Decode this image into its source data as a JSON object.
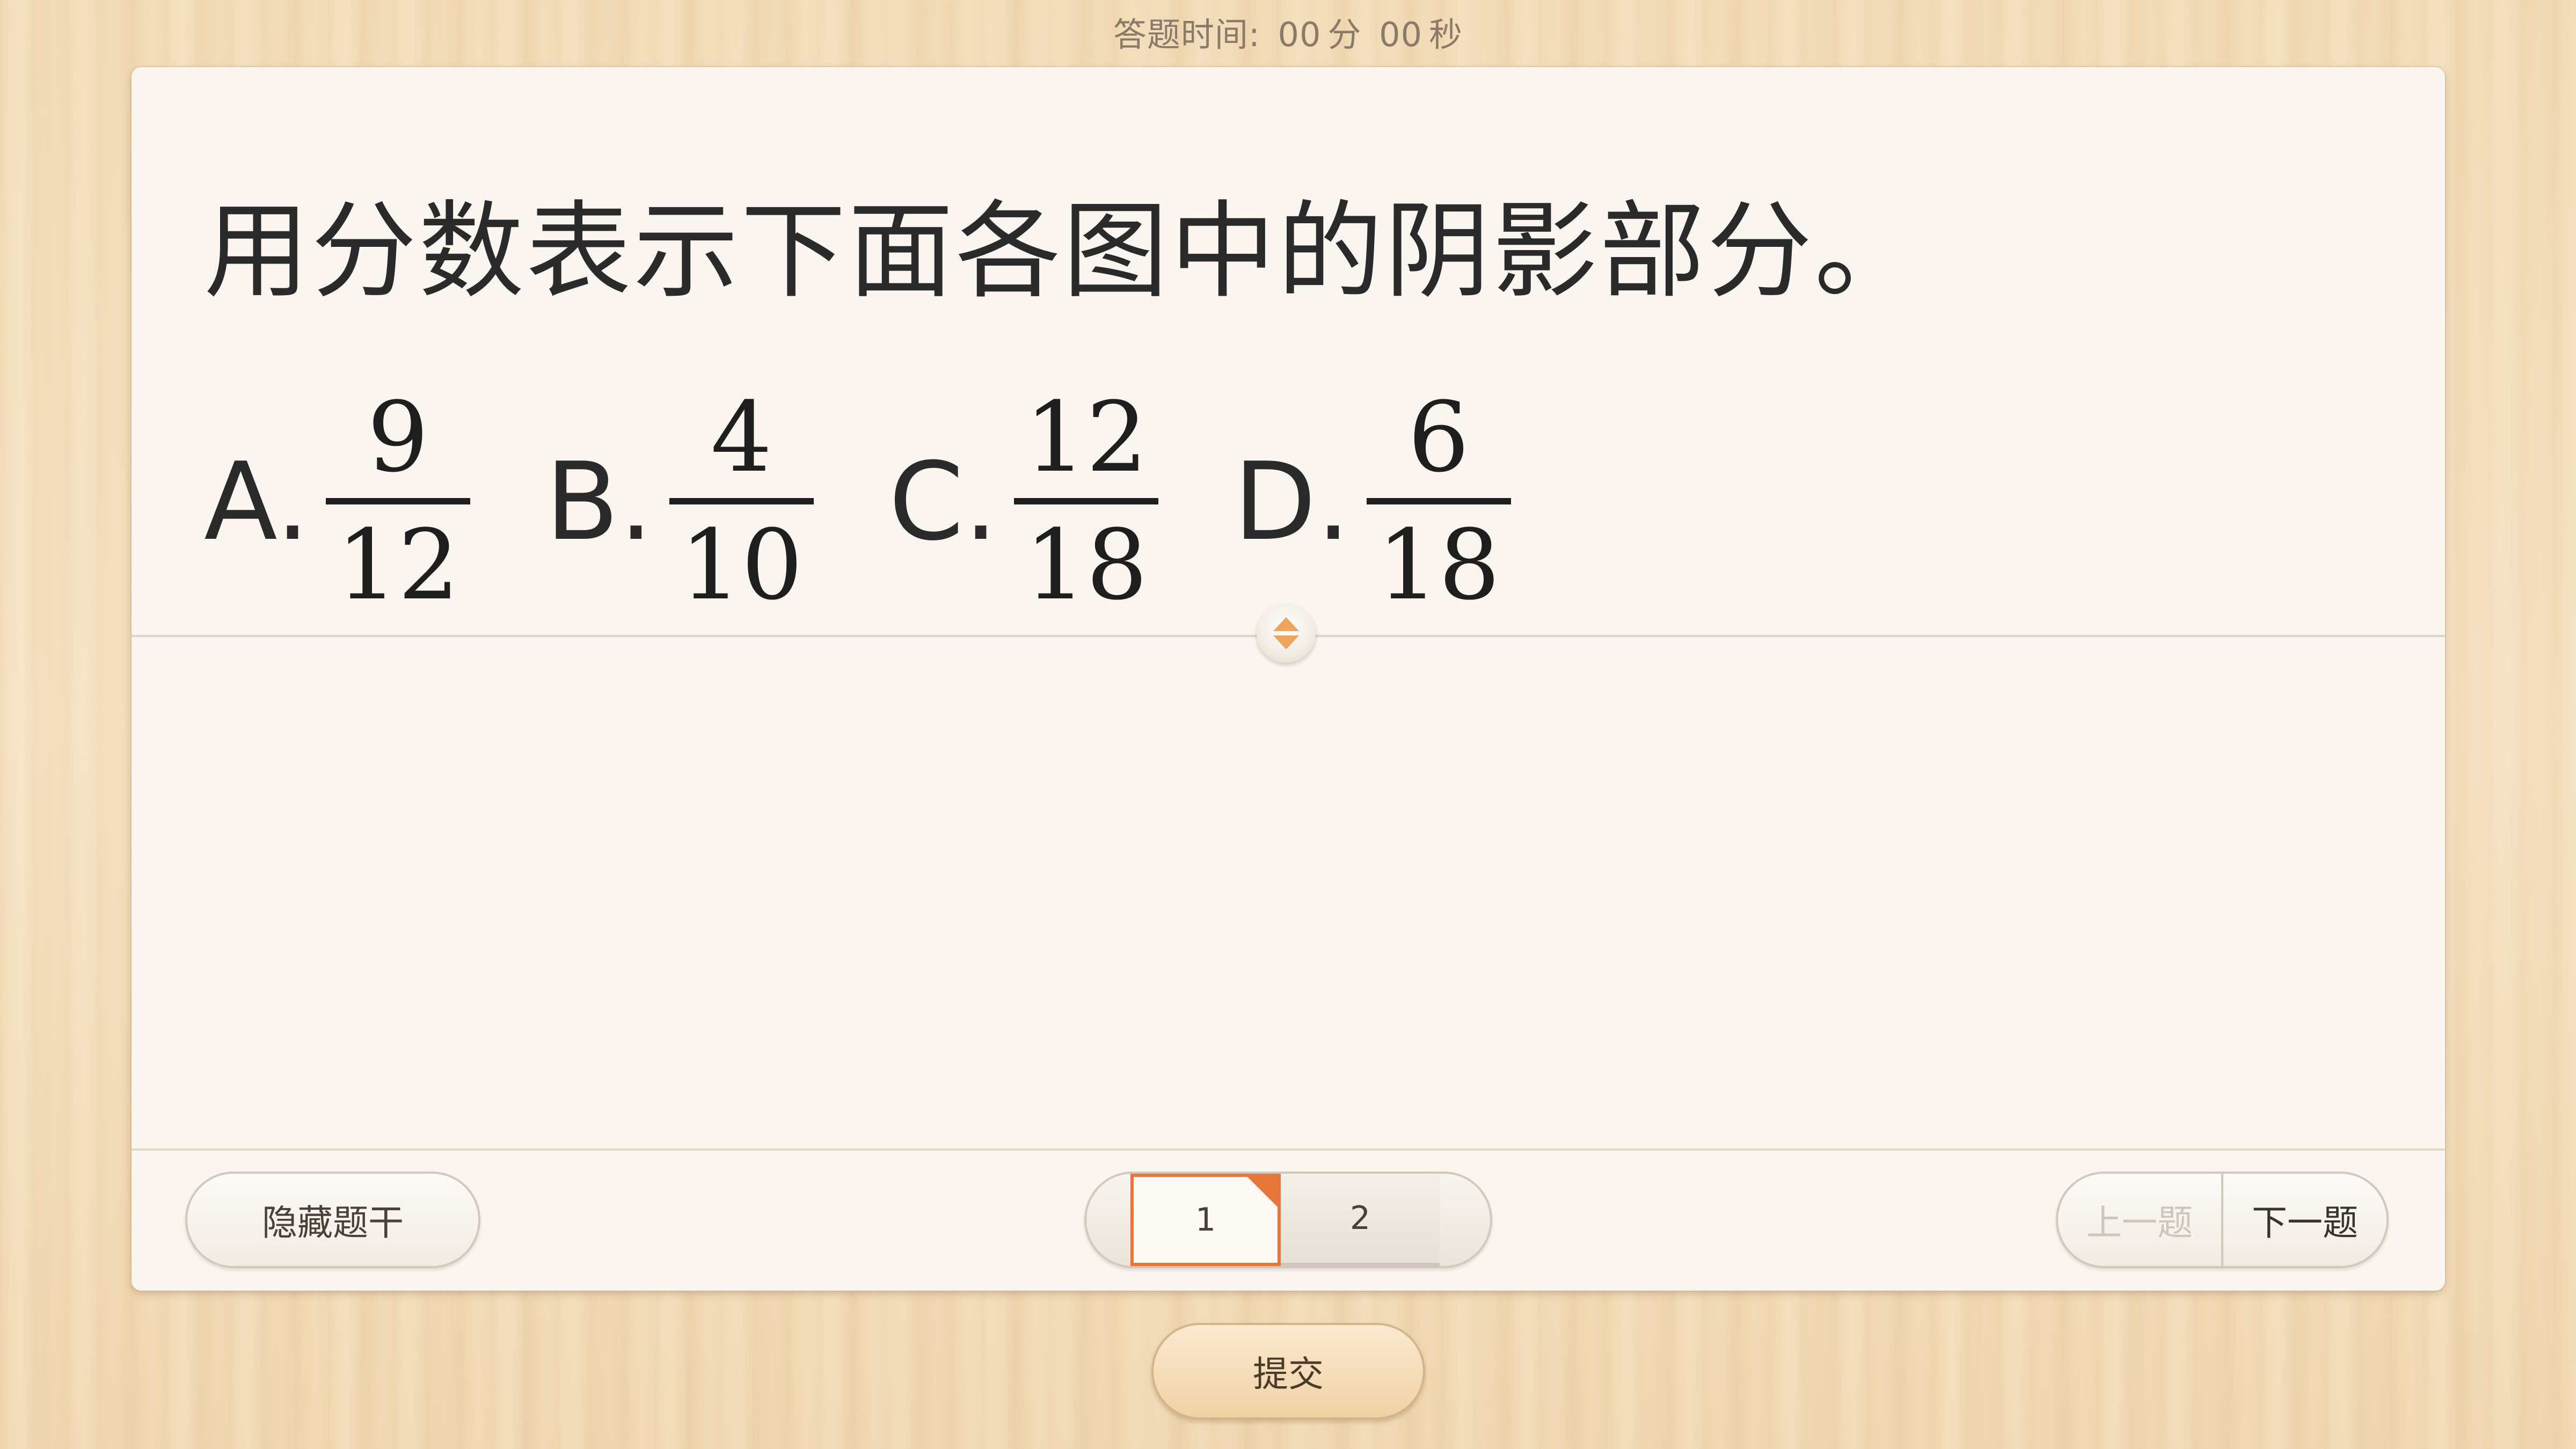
{
  "timer": {
    "label": "答题时间:",
    "minutes": "00",
    "minutes_unit": "分",
    "seconds": "00",
    "seconds_unit": "秒"
  },
  "question": {
    "title": "用分数表示下面各图中的阴影部分。",
    "options": [
      {
        "letter": "A.",
        "numerator": "9",
        "denominator": "12"
      },
      {
        "letter": "B.",
        "numerator": "4",
        "denominator": "10"
      },
      {
        "letter": "C.",
        "numerator": "12",
        "denominator": "18"
      },
      {
        "letter": "D.",
        "numerator": "6",
        "denominator": "18"
      }
    ]
  },
  "footer": {
    "hide_label": "隐藏题干",
    "pages": [
      "1",
      "2"
    ],
    "current_page": "1",
    "prev_label": "上一题",
    "next_label": "下一题"
  },
  "submit_label": "提交",
  "colors": {
    "accent": "#e8763a",
    "handle": "#f0a35a",
    "card_bg": "#faf5ee"
  }
}
